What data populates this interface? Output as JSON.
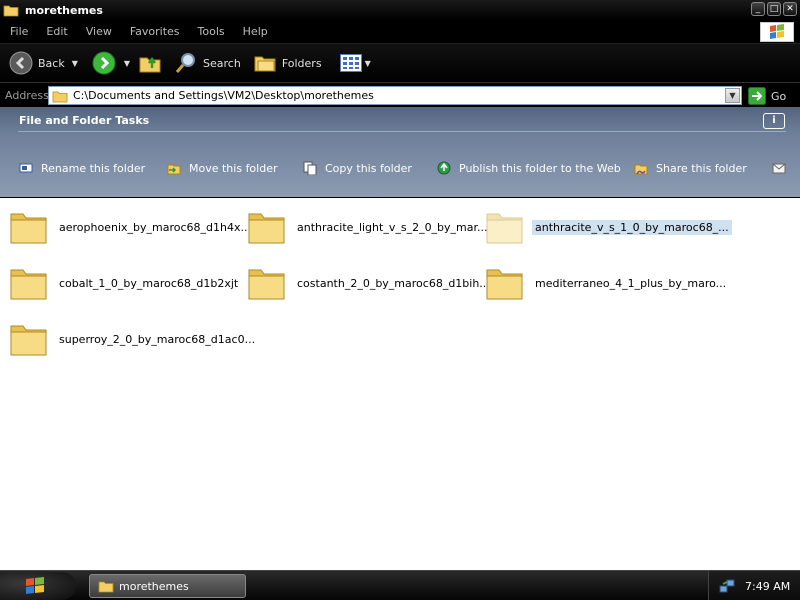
{
  "window": {
    "title": "morethemes",
    "controls": [
      "minimize",
      "maximize",
      "close"
    ]
  },
  "menu": {
    "items": [
      "File",
      "Edit",
      "View",
      "Favorites",
      "Tools",
      "Help"
    ]
  },
  "toolbar": {
    "back_label": "Back",
    "search_label": "Search",
    "folders_label": "Folders"
  },
  "address": {
    "label": "Address",
    "value": "C:\\Documents and Settings\\VM2\\Desktop\\morethemes",
    "go_label": "Go"
  },
  "tasks": {
    "title": "File and Folder Tasks",
    "items": [
      {
        "label": "Rename this folder",
        "icon": "rename-icon"
      },
      {
        "label": "Move this folder",
        "icon": "move-icon"
      },
      {
        "label": "Copy this folder",
        "icon": "copy-icon"
      },
      {
        "label": "Publish this folder to the Web",
        "icon": "publish-web-icon"
      },
      {
        "label": "Share this folder",
        "icon": "share-icon"
      }
    ]
  },
  "folders": [
    {
      "name": "aerophoenix_by_maroc68_d1h4x...",
      "selected": false
    },
    {
      "name": "anthracite_light_v_s_2_0_by_mar...",
      "selected": false
    },
    {
      "name": "anthracite_v_s_1_0_by_maroc68_...",
      "selected": true
    },
    {
      "name": "cobalt_1_0_by_maroc68_d1b2xjt",
      "selected": false
    },
    {
      "name": "costanth_2_0_by_maroc68_d1bih...",
      "selected": false
    },
    {
      "name": "mediterraneo_4_1_plus_by_maro...",
      "selected": false
    },
    {
      "name": "superroy_2_0_by_maroc68_d1ac0...",
      "selected": false
    }
  ],
  "taskbar": {
    "window_label": "morethemes",
    "clock": "7:49 AM"
  },
  "colors": {
    "task_pane_top": "#53647e",
    "task_pane_bottom": "#8c9cb3",
    "selection": "#cfe0ef",
    "folder_yellow": "#f5d878"
  }
}
